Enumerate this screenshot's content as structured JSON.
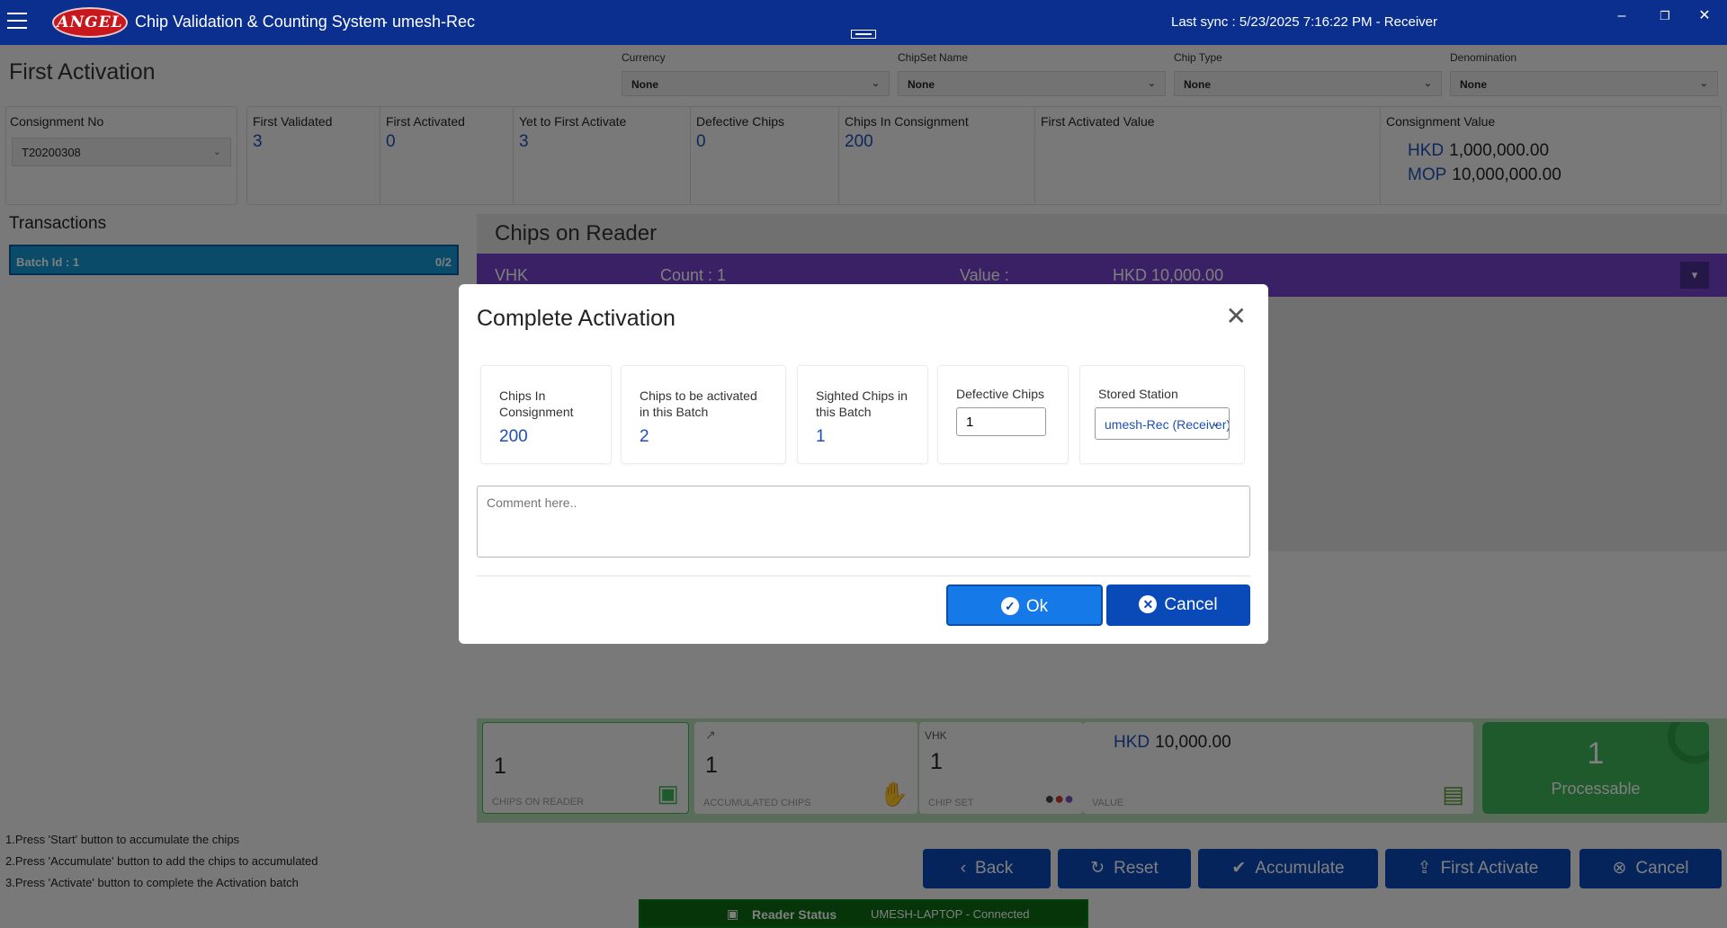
{
  "titlebar": {
    "logo_text": "ANGEL",
    "app_title": "Chip Validation & Counting System",
    "user": "- umesh-Rec",
    "last_sync": "Last sync :  5/23/2025 7:16:22 PM   - Receiver",
    "minimize": "–",
    "restore": "❐",
    "close": "✕"
  },
  "page": {
    "title": "First Activation"
  },
  "filters": [
    {
      "label": "Currency",
      "value": "None"
    },
    {
      "label": "ChipSet Name",
      "value": "None"
    },
    {
      "label": "Chip Type",
      "value": "None"
    },
    {
      "label": "Denomination",
      "value": "None"
    }
  ],
  "consignment": {
    "label": "Consignment No",
    "value": "T20200308"
  },
  "stats": {
    "first_validated": {
      "label": "First Validated",
      "value": "3"
    },
    "first_activated": {
      "label": "First Activated",
      "value": "0"
    },
    "yet_to_activate": {
      "label": "Yet to First Activate",
      "value": "3"
    },
    "defective": {
      "label": "Defective Chips",
      "value": "0"
    },
    "in_consignment": {
      "label": "Chips In Consignment",
      "value": "200"
    },
    "activated_value": {
      "label": "First Activated Value"
    },
    "consignment_value": {
      "label": "Consignment Value",
      "rows": [
        {
          "currency": "HKD",
          "amount": "1,000,000.00"
        },
        {
          "currency": "MOP",
          "amount": "10,000,000.00"
        }
      ]
    }
  },
  "transactions": {
    "title": "Transactions",
    "batch": {
      "label": "Batch Id :  1",
      "count": "0/2"
    }
  },
  "reader": {
    "title": "Chips on Reader",
    "bar": {
      "chipset": "VHK",
      "count": "Count : 1",
      "value_label": "Value :",
      "value": "HKD 10,000.00"
    }
  },
  "summary": {
    "on_reader": {
      "value": "1",
      "caption": "CHIPS ON READER"
    },
    "accumulated": {
      "value": "1",
      "caption": "ACCUMULATED CHIPS"
    },
    "chipset": {
      "name": "VHK",
      "value": "1",
      "caption": "CHIP SET"
    },
    "value": {
      "currency": "HKD",
      "amount": "10,000.00",
      "caption": "VALUE"
    },
    "processable": {
      "value": "1",
      "label": "Processable"
    }
  },
  "help": [
    "1.Press 'Start' button to accumulate the chips",
    "2.Press 'Accumulate' button to add the chips to accumulated",
    "3.Press 'Activate' button to complete the Activation batch"
  ],
  "actions": {
    "back": "Back",
    "reset": "Reset",
    "accumulate": "Accumulate",
    "first_activate": "First Activate",
    "cancel": "Cancel"
  },
  "reader_status": {
    "label": "Reader Status",
    "value": "UMESH-LAPTOP - Connected"
  },
  "modal": {
    "title": "Complete Activation",
    "chips_in_consignment": {
      "label": "Chips In Consignment",
      "value": "200"
    },
    "chips_to_activate": {
      "label": "Chips to be activated in this Batch",
      "value": "2"
    },
    "sighted_chips": {
      "label": "Sighted Chips in this Batch",
      "value": "1"
    },
    "defective_chips": {
      "label": "Defective Chips",
      "value": "1"
    },
    "stored_station": {
      "label": "Stored Station",
      "value": "umesh-Rec (Receiver)"
    },
    "comment_placeholder": "Comment here..",
    "ok": "Ok",
    "cancel": "Cancel"
  },
  "colors": {
    "titlebar": "#0a2f8f",
    "accent_blue": "#1e4fb5",
    "reader_bar": "#7440c8",
    "processable": "#3eb45b",
    "status_bar": "#0b6b10"
  }
}
